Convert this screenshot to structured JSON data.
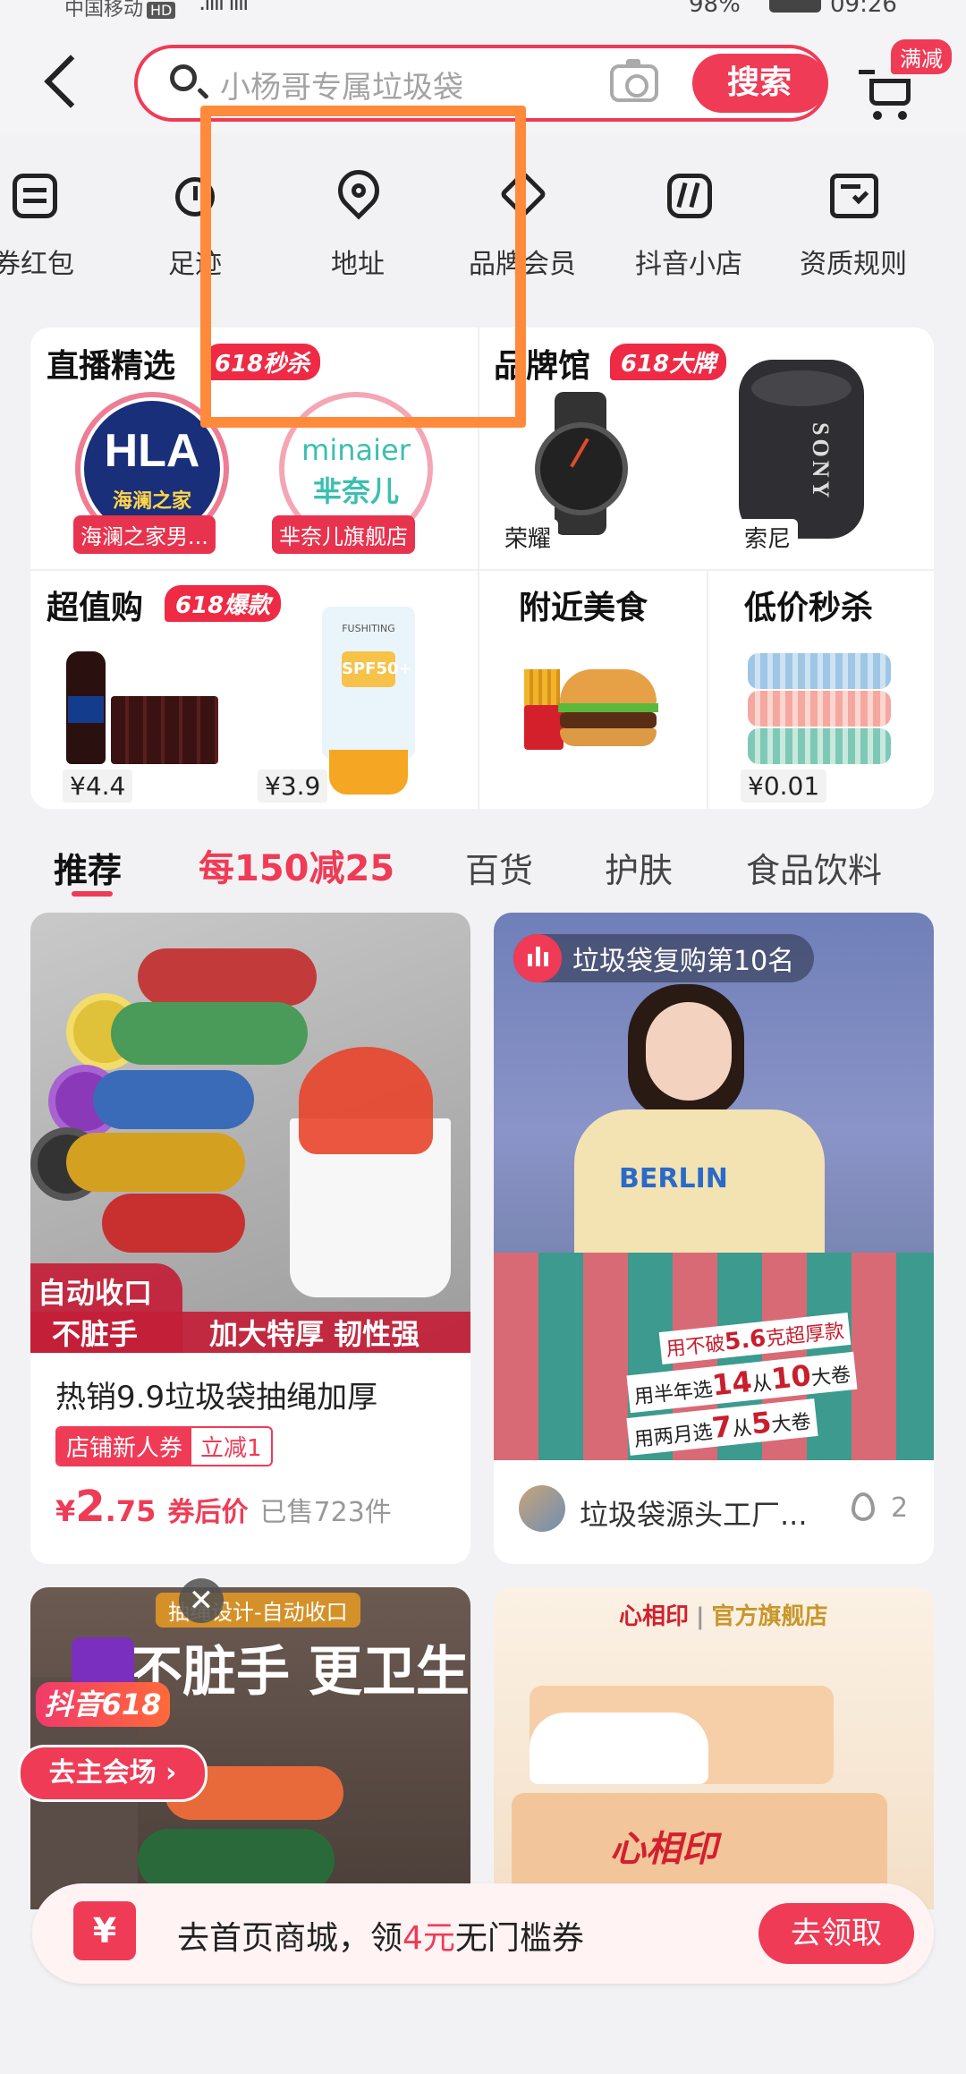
{
  "status_bar": {
    "carrier": "中国移动",
    "hd": "HD",
    "battery": "98%",
    "time": "09:26"
  },
  "header": {
    "search_placeholder": "小杨哥专属垃圾袋",
    "search_button": "搜索",
    "cart_badge": "满减"
  },
  "quick_nav": [
    {
      "label": "券红包",
      "icon": "coupon-icon"
    },
    {
      "label": "足迹",
      "icon": "footprint-icon"
    },
    {
      "label": "地址",
      "icon": "location-pin-icon"
    },
    {
      "label": "品牌会员",
      "icon": "diamond-icon"
    },
    {
      "label": "抖音小店",
      "icon": "store-icon"
    },
    {
      "label": "资质规则",
      "icon": "certificate-icon"
    }
  ],
  "promo": {
    "live": {
      "title": "直播精选",
      "tag": "618秒杀",
      "shops": [
        {
          "logo": "HLA",
          "logo_sub": "海澜之家",
          "label": "海澜之家男..."
        },
        {
          "logo": "minaier",
          "logo_sub": "芈奈儿",
          "label": "芈奈儿旗舰店"
        }
      ]
    },
    "brand": {
      "title": "品牌馆",
      "tag": "618大牌",
      "items": [
        {
          "label": "荣耀"
        },
        {
          "label": "索尼",
          "brand_mark": "SONY"
        }
      ]
    },
    "value": {
      "title": "超值购",
      "tag": "618爆款",
      "items": [
        {
          "price": "¥4.4"
        },
        {
          "price": "¥3.9",
          "brand_mark": "FUSHITING",
          "spf": "SPF50+"
        }
      ]
    },
    "food": {
      "title": "附近美食"
    },
    "flash": {
      "title": "低价秒杀",
      "price": "¥0.01"
    }
  },
  "tabs": [
    {
      "label": "推荐",
      "active": true
    },
    {
      "label": "每150减25",
      "highlight": true
    },
    {
      "label": "百货"
    },
    {
      "label": "护肤"
    },
    {
      "label": "食品饮料"
    }
  ],
  "feed": [
    {
      "overlay_left_1": "自动收口",
      "overlay_left_2": "不脏手",
      "overlay_right": "加大特厚 韧性强",
      "title": "热销9.9垃圾袋抽绳加厚",
      "coupon_a": "店铺新人券",
      "coupon_b": "立减1",
      "price_symbol": "¥",
      "price_int": "2",
      "price_dec": ".75",
      "price_note": "券后价",
      "sold": "已售723件"
    },
    {
      "live_badge": "垃圾袋复购第10名",
      "shirt_text": "BERLIN",
      "sign_1": "用不破",
      "sign_1_num": "5.6",
      "sign_1_suffix": "克超厚款",
      "sign_2": "用半年选",
      "sign_2_a": "14",
      "sign_2_mid": "从",
      "sign_2_b": "10",
      "sign_2_unit": "大卷",
      "sign_3": "用两月选",
      "sign_3_a": "7",
      "sign_3_mid": "从",
      "sign_3_b": "5",
      "sign_3_unit": "大卷",
      "shop": "垃圾袋源头工厂...",
      "hot_count": "2"
    },
    {
      "top_tag": "抽绳设计-自动收口",
      "headline": "不脏手 更卫生",
      "float_badge": "抖音618",
      "float_button": "去主会场 ›"
    },
    {
      "brand": "心相印",
      "brand_sub": "官方旗舰店",
      "pack_text": "心相印"
    }
  ],
  "banner": {
    "icon": "¥",
    "text_a": "去首页商城，领",
    "text_amount": "4元",
    "text_b": "无门槛券",
    "button": "去领取"
  },
  "colors": {
    "accent": "#ef3b56",
    "highlight_box": "#ff8a3c"
  }
}
